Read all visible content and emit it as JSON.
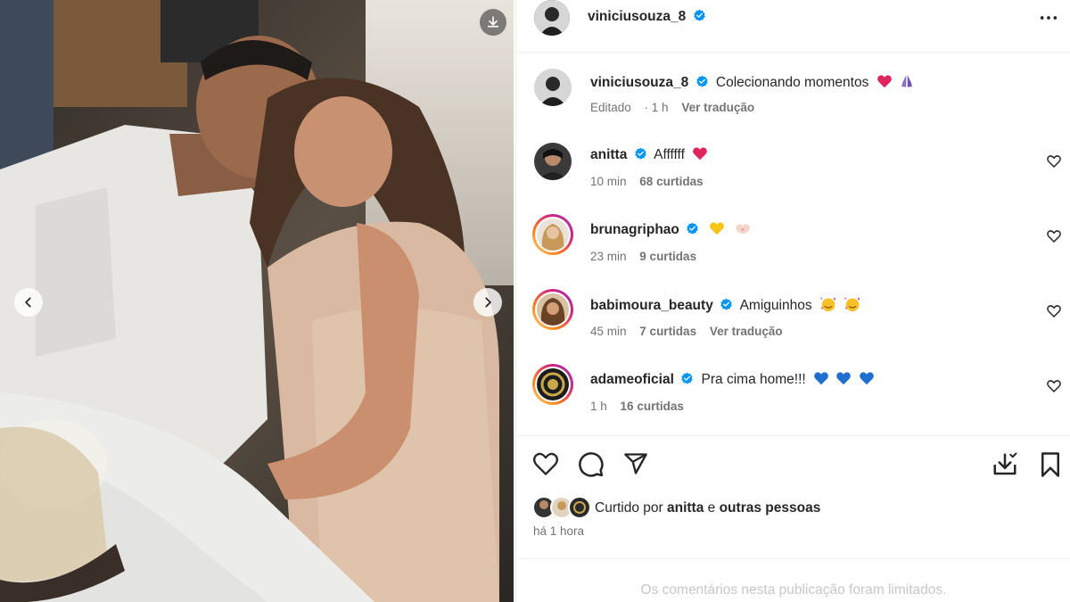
{
  "post": {
    "username": "viniciusouza_8",
    "caption": "Colecionando momentos",
    "caption_emojis": [
      "red-heart-emoji",
      "praying-hands-emoji"
    ],
    "edited_label": "Editado",
    "time": "1 h",
    "translate_label": "Ver tradução"
  },
  "comments": [
    {
      "username": "anitta",
      "text": "Affffff",
      "emojis": [
        "red-heart-emoji"
      ],
      "time": "10 min",
      "likes": "68 curtidas",
      "translate": ""
    },
    {
      "username": "brunagriphao",
      "text": "",
      "emojis": [
        "yellow-heart-emoji",
        "heart-hands-emoji"
      ],
      "time": "23 min",
      "likes": "9 curtidas",
      "translate": ""
    },
    {
      "username": "babimoura_beauty",
      "text": "Amiguinhos",
      "emojis": [
        "smiling-face-hearts-emoji",
        "smiling-face-hearts-emoji"
      ],
      "time": "45 min",
      "likes": "7 curtidas",
      "translate": "Ver tradução"
    },
    {
      "username": "adameoficial",
      "text": "Pra cima home!!!",
      "emojis": [
        "blue-heart-emoji",
        "blue-heart-emoji",
        "blue-heart-emoji"
      ],
      "time": "1 h",
      "likes": "16 curtidas",
      "translate": ""
    }
  ],
  "likes_summary": {
    "prefix": "Curtido por",
    "user": "anitta",
    "connector": "e",
    "others": "outras pessoas"
  },
  "timestamp": "há 1 hora",
  "comments_limited": "Os comentários nesta publicação foram limitados.",
  "colors": {
    "verified": "#0095f6",
    "red_heart": "#e0245e",
    "blue_heart": "#1f6fd1",
    "yellow_heart": "#f5c518",
    "muted": "#737373",
    "story_ring_start": "#feda75",
    "story_ring_end": "#d62976"
  },
  "icons": [
    "download-icon",
    "more-options-icon",
    "heart-icon",
    "comment-icon",
    "share-icon",
    "save-collection-icon",
    "bookmark-icon",
    "chevron-left-icon",
    "chevron-right-icon"
  ]
}
